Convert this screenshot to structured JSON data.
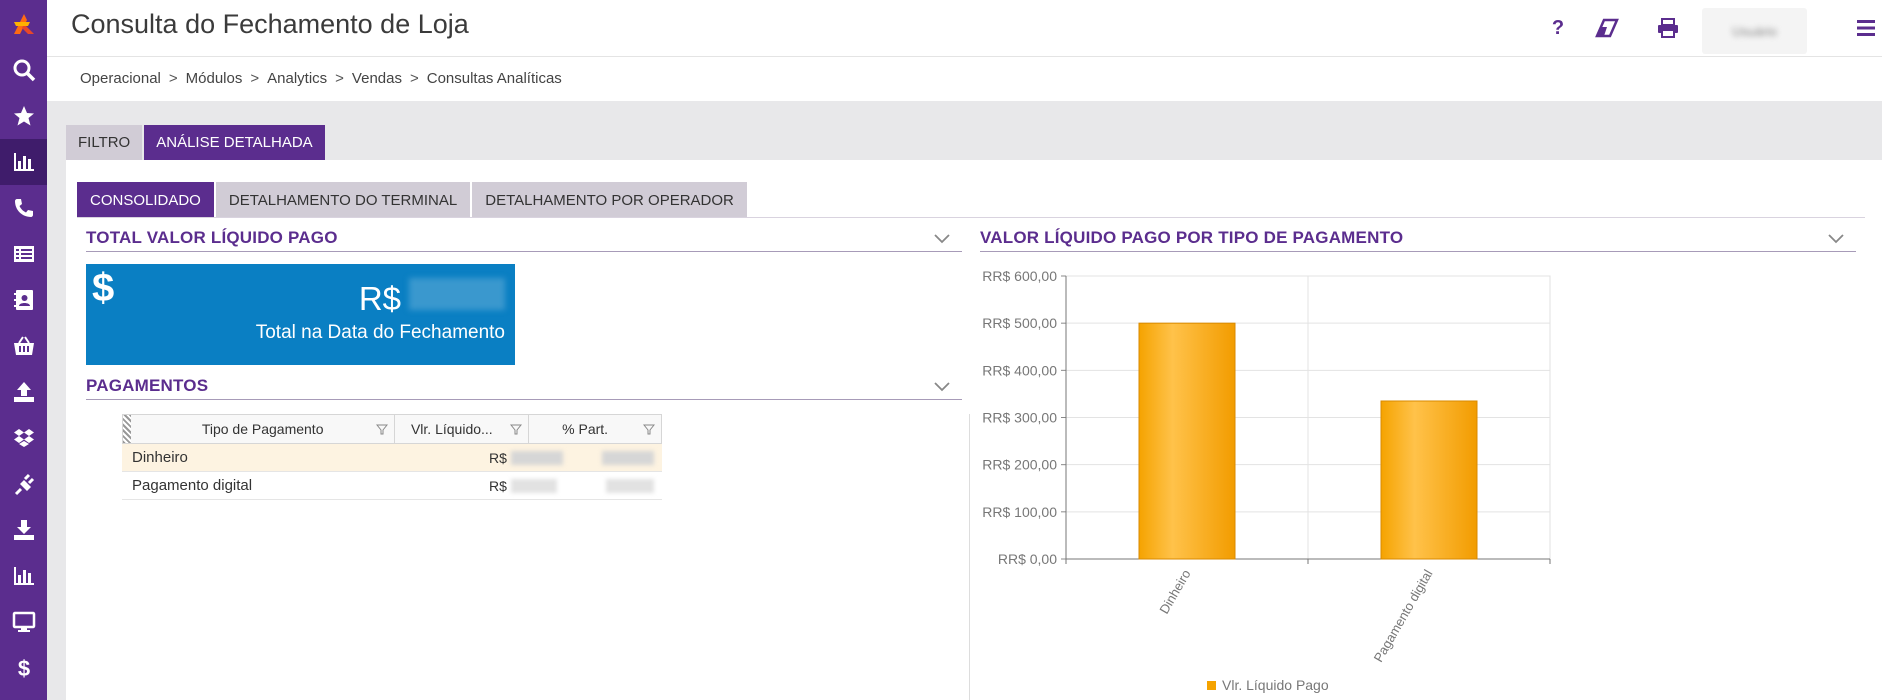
{
  "app": {
    "title": "Consulta do Fechamento de Loja",
    "user": "Usuário"
  },
  "colors": {
    "brand": "#5b2d8e",
    "accent": "#f0a100",
    "kpi_bg": "#0a7fc3"
  },
  "topbar_icons": [
    "help-icon",
    "eraser-icon",
    "print-icon",
    "menu-icon"
  ],
  "sidebar": {
    "icons": [
      "search-icon",
      "star-icon",
      "bar-chart-icon",
      "phone-icon",
      "list-icon",
      "contact-icon",
      "basket-icon",
      "upload-icon",
      "dropbox-icon",
      "plug-icon",
      "download-icon",
      "report-icon",
      "monitor-icon",
      "dollar-icon"
    ],
    "active": "bar-chart-icon"
  },
  "breadcrumb": {
    "items": [
      "Operacional",
      "Módulos",
      "Analytics",
      "Vendas",
      "Consultas Analíticas"
    ],
    "separator": ">"
  },
  "tabs": {
    "filtro": "FILTRO",
    "analise": "ANÁLISE DETALHADA"
  },
  "subtabs": {
    "consolidado": "CONSOLIDADO",
    "terminal": "DETALHAMENTO DO TERMINAL",
    "operador": "DETALHAMENTO POR OPERADOR"
  },
  "sections": {
    "total": "TOTAL VALOR LÍQUIDO PAGO",
    "pagamentos": "PAGAMENTOS",
    "chart": "VALOR LÍQUIDO PAGO POR TIPO DE PAGAMENTO"
  },
  "kpi": {
    "icon": "$",
    "currency": "R$",
    "label": "Total na Data do Fechamento"
  },
  "grid": {
    "headers": [
      "Tipo de Pagamento",
      "Vlr. Líquido...",
      "% Part."
    ],
    "rows": [
      {
        "tipo": "Dinheiro",
        "currency": "R$"
      },
      {
        "tipo": "Pagamento digital",
        "currency": "R$"
      }
    ]
  },
  "chart_data": {
    "type": "bar",
    "categories": [
      "Dinheiro",
      "Pagamento digital"
    ],
    "series": [
      {
        "name": "Vlr. Líquido Pago",
        "values": [
          500,
          335
        ]
      }
    ],
    "ylim": [
      0,
      600
    ],
    "yticks": [
      "RR$ 0,00",
      "RR$ 100,00",
      "RR$ 200,00",
      "RR$ 300,00",
      "RR$ 400,00",
      "RR$ 500,00",
      "RR$ 600,00"
    ],
    "grid": true,
    "legend": "bottom"
  }
}
